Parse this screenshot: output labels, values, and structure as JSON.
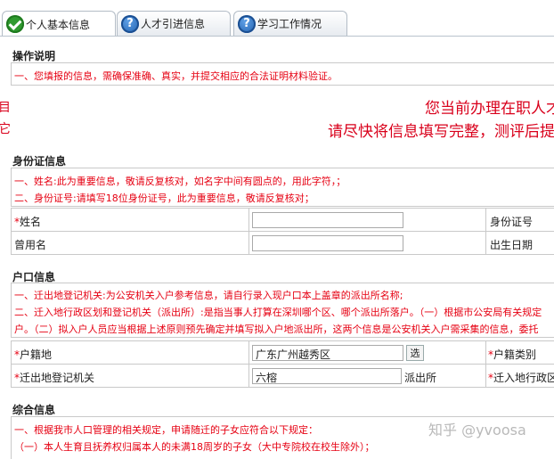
{
  "tabs": [
    {
      "label": "个人基本信息",
      "icon": "check-icon",
      "active": true
    },
    {
      "label": "人才引进信息",
      "icon": "question-icon",
      "active": false
    },
    {
      "label": "学习工作情况",
      "icon": "question-icon",
      "active": false
    }
  ],
  "sections": {
    "instructions": {
      "title": "操作说明",
      "note": "一、您填报的信息，需确保准确、真实，并提交相应的合法证明材料验证。"
    },
    "banner": {
      "line1": "您当前办理在职人才",
      "line2": "请尽快将信息填写完整，测评后提",
      "edge_top": "目",
      "edge_bottom": "它"
    },
    "id_info": {
      "title": "身份证信息",
      "notes": [
        "一、姓名:此为重要信息，敬请反复核对，如名字中间有圆点的，用此字符，；",
        "二、身份证号:请填写18位身份证号，此为重要信息，敬请反复核对；"
      ],
      "rows": [
        {
          "label": "姓名",
          "required": true,
          "right_label": "身份证号"
        },
        {
          "label": "曾用名",
          "required": false,
          "right_label": "出生日期"
        }
      ]
    },
    "hukou": {
      "title": "户口信息",
      "notes": [
        "一、迁出地登记机关:为公安机关入户参考信息，请自行录入现户口本上盖章的派出所名称;",
        "二、迁入地行政区划和登记机关（派出所）:是指当事人打算在深圳哪个区、哪个派出所落户。（一）根据市公安局有关规定",
        "户。（二）拟入户人员应当根据上述原则预先确定并填写拟入户地派出所，这两个信息是公安机关入户需采集的信息，委托"
      ],
      "rows": [
        {
          "label": "户籍地",
          "required": true,
          "value": "广东广州越秀区",
          "button": "选",
          "right_label": "户籍类别",
          "right_required": true
        },
        {
          "label": "迁出地登记机关",
          "required": true,
          "value": "六榕",
          "suffix": "派出所",
          "right_label": "迁入地行政区",
          "right_required": true
        }
      ]
    },
    "general": {
      "title": "综合信息",
      "notes": [
        "一、根据我市人口管理的相关规定，申请随迁的子女应符合以下规定：",
        "（一）本人生育且抚养权归属本人的未满18周岁的子女（大中专院校在校生除外）；"
      ]
    }
  },
  "watermark": "知乎 @yvoosa",
  "colors": {
    "note_red": "#e60012",
    "banner_red": "#d9001b",
    "border": "#c9c9c9"
  }
}
